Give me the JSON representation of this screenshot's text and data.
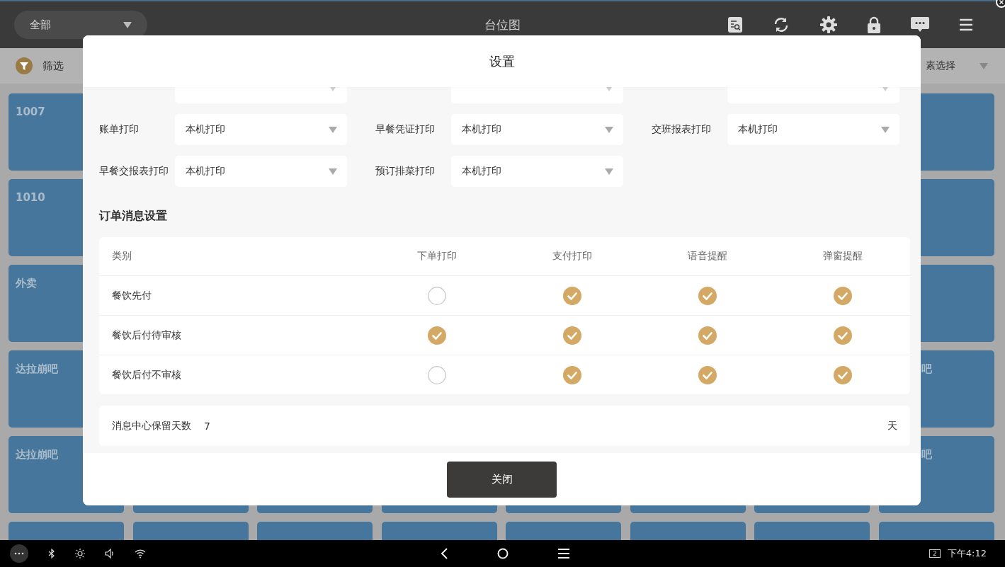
{
  "top_bar": {
    "area_select": "全部",
    "title": "台位图"
  },
  "filter_bar": {
    "filter_label": "筛选",
    "element_select": "素选择"
  },
  "tile_rows": [
    {
      "kind": "full",
      "first": "1007"
    },
    {
      "kind": "full",
      "first": "1010"
    },
    {
      "kind": "full",
      "first": "外卖"
    },
    {
      "kind": "full",
      "first": "达拉崩吧",
      "last": "吧"
    },
    {
      "kind": "full",
      "first": "达拉崩吧",
      "last": "吧"
    },
    {
      "kind": "cut"
    }
  ],
  "modal": {
    "title": "设置",
    "print_settings": [
      {
        "kind": "cut"
      },
      {
        "kind": "cut"
      },
      {
        "kind": "cut"
      },
      {
        "label": "账单打印",
        "value": "本机打印"
      },
      {
        "label": "早餐凭证打印",
        "value": "本机打印"
      },
      {
        "label": "交班报表打印",
        "value": "本机打印"
      },
      {
        "label": "早餐交报表打印",
        "value": "本机打印"
      },
      {
        "label": "预订排菜打印",
        "value": "本机打印"
      }
    ],
    "order_messages": {
      "title": "订单消息设置",
      "columns": [
        "类别",
        "下单打印",
        "支付打印",
        "语音提醒",
        "弹窗提醒"
      ],
      "rows": [
        {
          "name": "餐饮先付",
          "checks": [
            false,
            true,
            true,
            true
          ]
        },
        {
          "name": "餐饮后付待审核",
          "checks": [
            true,
            true,
            true,
            true
          ]
        },
        {
          "name": "餐饮后付不审核",
          "checks": [
            false,
            true,
            true,
            true
          ]
        }
      ]
    },
    "retention": {
      "label": "消息中心保留天数",
      "value": "7",
      "unit": "天"
    },
    "close_button": "关闭"
  },
  "nav_bar": {
    "screen_badge": "2",
    "time": "下午4:12"
  }
}
